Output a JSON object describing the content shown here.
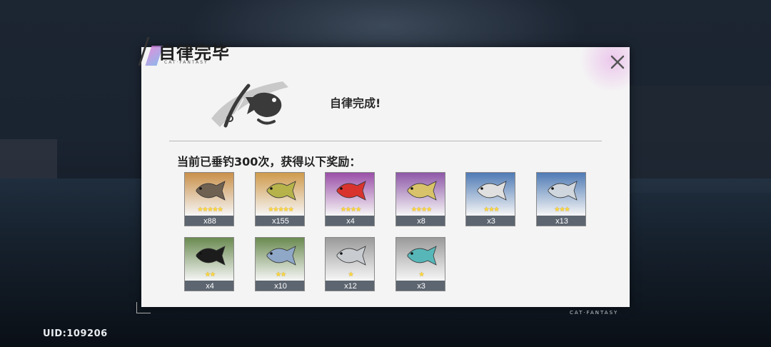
{
  "window": {
    "title": "自律完毕",
    "title_sub": "CAT·FANTASY",
    "close_label": "×"
  },
  "header": {
    "icon": "fishing-rod-fish-icon",
    "complete_text": "自律完成!"
  },
  "rewards": {
    "caption": "当前已垂钓300次，获得以下奖励：",
    "items": [
      {
        "count": "x88",
        "stars": "★★★★★",
        "bg": "#c9904a",
        "fish_color": "#6f6152",
        "icon": "stingray-icon"
      },
      {
        "count": "x155",
        "stars": "★★★★★",
        "bg": "#cf9a4c",
        "fish_color": "#b6b34a",
        "icon": "yellow-fish-icon"
      },
      {
        "count": "x4",
        "stars": "★★★★",
        "bg": "#9a4fa8",
        "fish_color": "#d9332e",
        "icon": "red-fish-icon"
      },
      {
        "count": "x8",
        "stars": "★★★★",
        "bg": "#8e58a8",
        "fish_color": "#d9c36a",
        "icon": "pompano-fish-icon"
      },
      {
        "count": "x3",
        "stars": "★★★",
        "bg": "#4f7bb5",
        "fish_color": "#e0e0e0",
        "icon": "striped-fish-icon"
      },
      {
        "count": "x13",
        "stars": "★★★",
        "bg": "#4f7bb5",
        "fish_color": "#cfd6de",
        "icon": "mackerel-icon"
      },
      {
        "count": "x4",
        "stars": "★★",
        "bg": "#6a8a50",
        "fish_color": "#1c1c1c",
        "icon": "black-white-fish-icon"
      },
      {
        "count": "x10",
        "stars": "★★",
        "bg": "#6a8a50",
        "fish_color": "#8fa8c8",
        "icon": "opah-fish-icon"
      },
      {
        "count": "x12",
        "stars": "★",
        "bg": "#9a9a9a",
        "fish_color": "#c8ccd0",
        "icon": "silver-fish-icon"
      },
      {
        "count": "x3",
        "stars": "★",
        "bg": "#9a9a9a",
        "fish_color": "#57b7b8",
        "icon": "parrot-fish-icon"
      }
    ]
  },
  "footer": {
    "uid_label": "UID:",
    "uid_value": "109206",
    "brand": "CAT·FANTASY"
  }
}
